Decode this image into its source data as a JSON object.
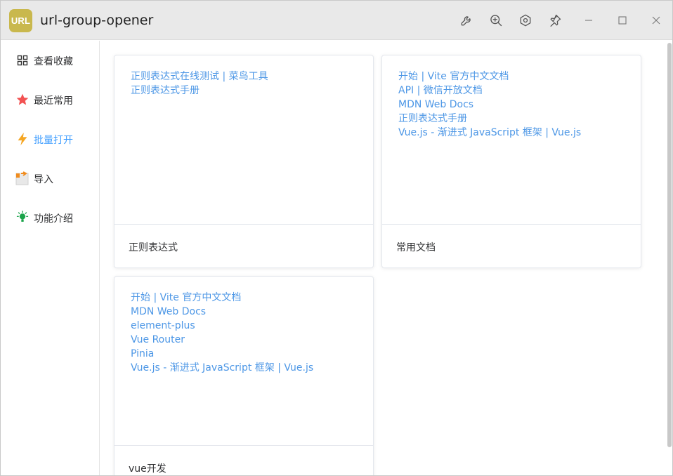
{
  "app": {
    "logo_text": "URL",
    "title": "url-group-opener"
  },
  "titlebar": {
    "icons": [
      "wrench-icon",
      "zoom-in-icon",
      "settings-hex-icon",
      "pin-icon",
      "minimize-icon",
      "maximize-icon",
      "close-icon"
    ]
  },
  "sidebar": {
    "items": [
      {
        "label": "查看收藏",
        "icon": "grid-icon",
        "active": false
      },
      {
        "label": "最近常用",
        "icon": "star-icon",
        "active": false,
        "color": "#f25252"
      },
      {
        "label": "批量打开",
        "icon": "lightning-icon",
        "active": true,
        "color": "#f5a623"
      },
      {
        "label": "导入",
        "icon": "import-icon",
        "active": false
      },
      {
        "label": "功能介绍",
        "icon": "lightbulb-icon",
        "active": false,
        "color": "#1aa34a"
      }
    ]
  },
  "groups": [
    {
      "name": "正则表达式",
      "links": [
        "正则表达式在线测试 | 菜鸟工具",
        "正则表达式手册"
      ]
    },
    {
      "name": "常用文档",
      "links": [
        "开始 | Vite 官方中文文档",
        "API | 微信开放文档",
        "MDN Web Docs",
        "正则表达式手册",
        "Vue.js - 渐进式 JavaScript 框架 | Vue.js"
      ]
    },
    {
      "name": "vue开发",
      "links": [
        "开始 | Vite 官方中文文档",
        "MDN Web Docs",
        "element-plus",
        "Vue Router",
        "Pinia",
        "Vue.js - 渐进式 JavaScript 框架 | Vue.js"
      ]
    }
  ],
  "colors": {
    "link": "#4d97e6",
    "active": "#409eff",
    "logo_bg": "#c9b84d"
  }
}
